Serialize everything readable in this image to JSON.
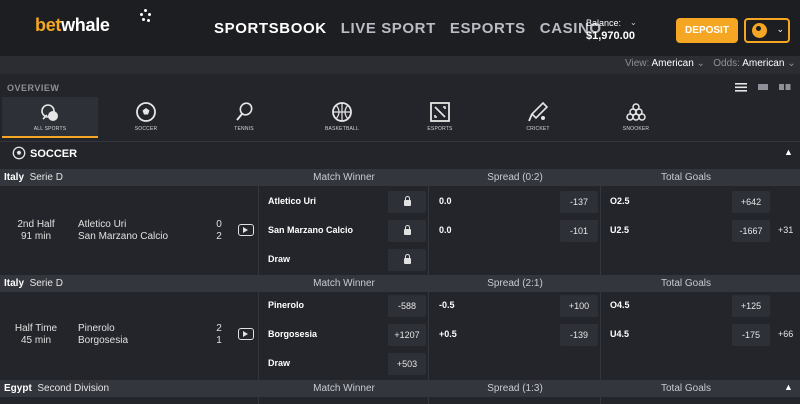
{
  "brand": {
    "bet": "bet",
    "whale": "whale",
    "accent": "#f5a623"
  },
  "nav": [
    {
      "label": "SPORTSBOOK",
      "active": true
    },
    {
      "label": "LIVE SPORT",
      "active": false
    },
    {
      "label": "ESPORTS",
      "active": false
    },
    {
      "label": "CASINO",
      "active": false
    }
  ],
  "balance": {
    "label": "Balance:",
    "amount": "$1,970.00"
  },
  "deposit_label": "DEPOSIT",
  "subbar": {
    "view_label": "View:",
    "view_value": "American",
    "odds_label": "Odds:",
    "odds_value": "American"
  },
  "overview_label": "OVERVIEW",
  "sports": [
    {
      "label": "ALL SPORTS",
      "icon": "all-sports-icon"
    },
    {
      "label": "SOCCER",
      "icon": "soccer-icon"
    },
    {
      "label": "TENNIS",
      "icon": "tennis-icon"
    },
    {
      "label": "BASKETBALL",
      "icon": "basketball-icon"
    },
    {
      "label": "ESPORTS",
      "icon": "esports-icon"
    },
    {
      "label": "CRICKET",
      "icon": "cricket-icon"
    },
    {
      "label": "SNOOKER",
      "icon": "snooker-icon"
    }
  ],
  "section_title": "SOCCER",
  "leagues": [
    {
      "country": "Italy",
      "name": "Serie D",
      "headers": {
        "match_winner": "Match Winner",
        "spread": "Spread (0:2)",
        "total": "Total Goals"
      },
      "match": {
        "period": "2nd Half",
        "minute": "91 min",
        "home": "Atletico Uri",
        "away": "San Marzano Calcio",
        "home_score": "0",
        "away_score": "2",
        "rows": [
          {
            "selection": "Atletico Uri",
            "winner_odds": "",
            "spread_line": "0.0",
            "spread_odds": "-137",
            "total_line": "O2.5",
            "total_odds": "+642"
          },
          {
            "selection": "San Marzano Calcio",
            "winner_odds": "",
            "spread_line": "0.0",
            "spread_odds": "-101",
            "total_line": "U2.5",
            "total_odds": "-1667"
          },
          {
            "selection": "Draw",
            "winner_odds": ""
          }
        ],
        "more": "+31"
      }
    },
    {
      "country": "Italy",
      "name": "Serie D",
      "headers": {
        "match_winner": "Match Winner",
        "spread": "Spread (2:1)",
        "total": "Total Goals"
      },
      "match": {
        "period": "Half Time",
        "minute": "45 min",
        "home": "Pinerolo",
        "away": "Borgosesia",
        "home_score": "2",
        "away_score": "1",
        "rows": [
          {
            "selection": "Pinerolo",
            "winner_odds": "-588",
            "spread_line": "-0.5",
            "spread_odds": "+100",
            "total_line": "O4.5",
            "total_odds": "+125"
          },
          {
            "selection": "Borgosesia",
            "winner_odds": "+1207",
            "spread_line": "+0.5",
            "spread_odds": "-139",
            "total_line": "U4.5",
            "total_odds": "-175"
          },
          {
            "selection": "Draw",
            "winner_odds": "+503"
          }
        ],
        "more": "+66"
      }
    },
    {
      "country": "Egypt",
      "name": "Second Division",
      "headers": {
        "match_winner": "Match Winner",
        "spread": "Spread (1:3)",
        "total": "Total Goals"
      }
    }
  ]
}
